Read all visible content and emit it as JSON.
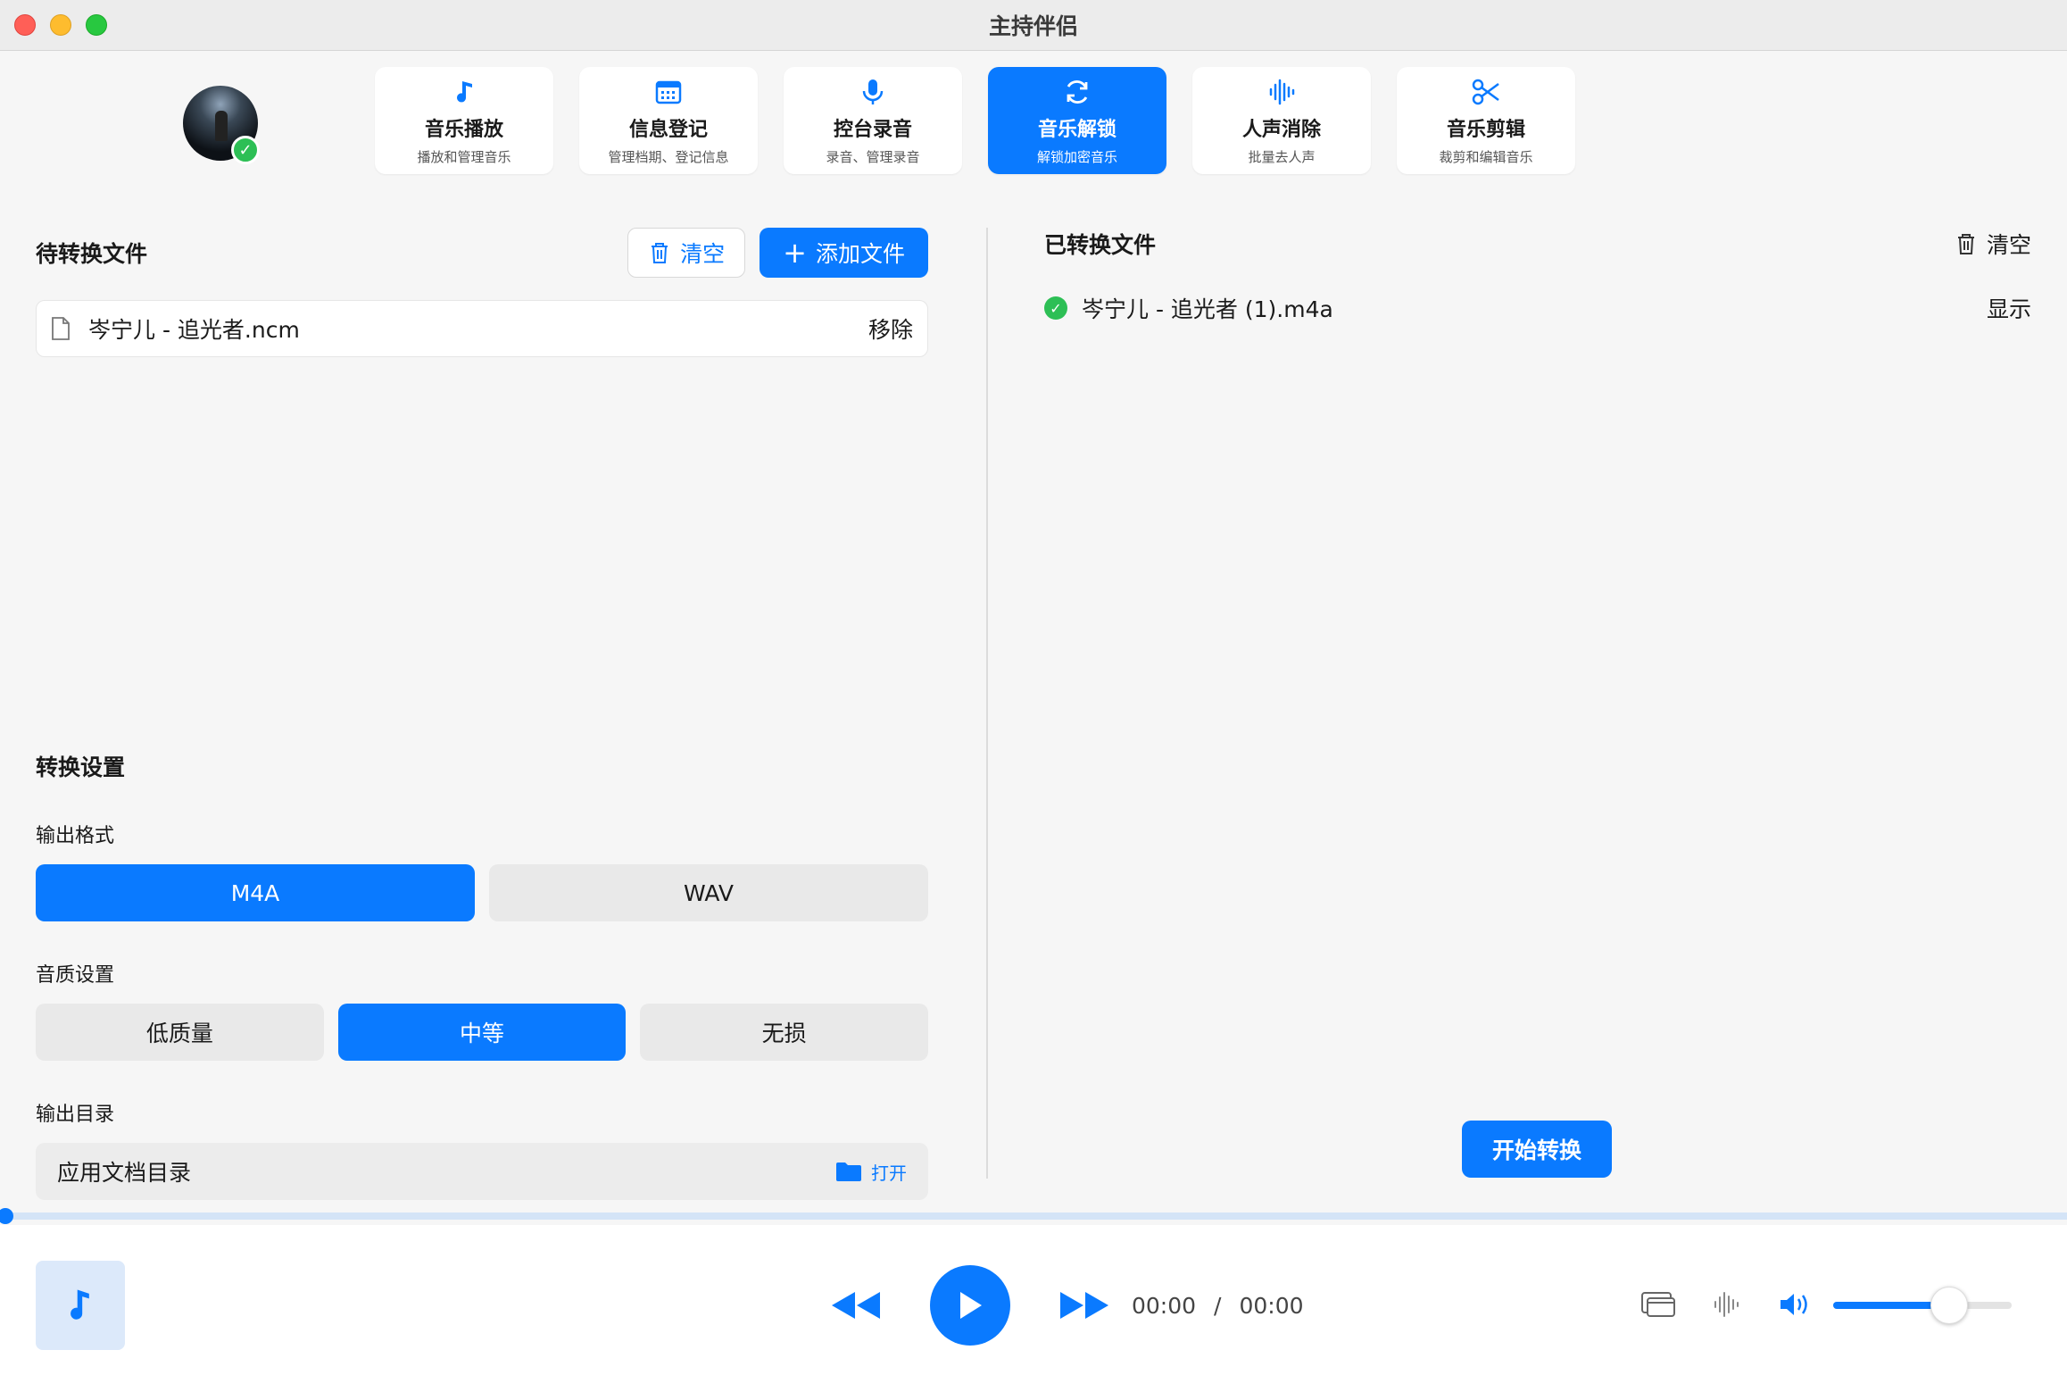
{
  "window": {
    "title": "主持伴侣"
  },
  "tabs": [
    {
      "label": "音乐播放",
      "sub": "播放和管理音乐",
      "icon": "music-note-icon",
      "active": false
    },
    {
      "label": "信息登记",
      "sub": "管理档期、登记信息",
      "icon": "calendar-icon",
      "active": false
    },
    {
      "label": "控台录音",
      "sub": "录音、管理录音",
      "icon": "microphone-icon",
      "active": false
    },
    {
      "label": "音乐解锁",
      "sub": "解锁加密音乐",
      "icon": "refresh-icon",
      "active": true
    },
    {
      "label": "人声消除",
      "sub": "批量去人声",
      "icon": "waveform-icon",
      "active": false
    },
    {
      "label": "音乐剪辑",
      "sub": "裁剪和编辑音乐",
      "icon": "scissors-icon",
      "active": false
    }
  ],
  "pending": {
    "title": "待转换文件",
    "clear_label": "清空",
    "add_label": "添加文件",
    "files": [
      {
        "name": "岑宁儿 - 追光者.ncm",
        "action": "移除"
      }
    ]
  },
  "settings": {
    "title": "转换设置",
    "format_label": "输出格式",
    "formats": [
      "M4A",
      "WAV"
    ],
    "selected_format": "M4A",
    "quality_label": "音质设置",
    "qualities": [
      "低质量",
      "中等",
      "无损"
    ],
    "selected_quality": "中等",
    "dir_label": "输出目录",
    "dir_value": "应用文档目录",
    "open_label": "打开"
  },
  "converted": {
    "title": "已转换文件",
    "clear_label": "清空",
    "files": [
      {
        "name": "岑宁儿 - 追光者 (1).m4a",
        "action": "显示"
      }
    ]
  },
  "start_label": "开始转换",
  "player": {
    "current_time": "00:00",
    "separator": "/",
    "total_time": "00:00",
    "progress": 0.0,
    "volume": 0.65
  },
  "colors": {
    "accent": "#0a7aff",
    "success": "#2dbf55"
  }
}
